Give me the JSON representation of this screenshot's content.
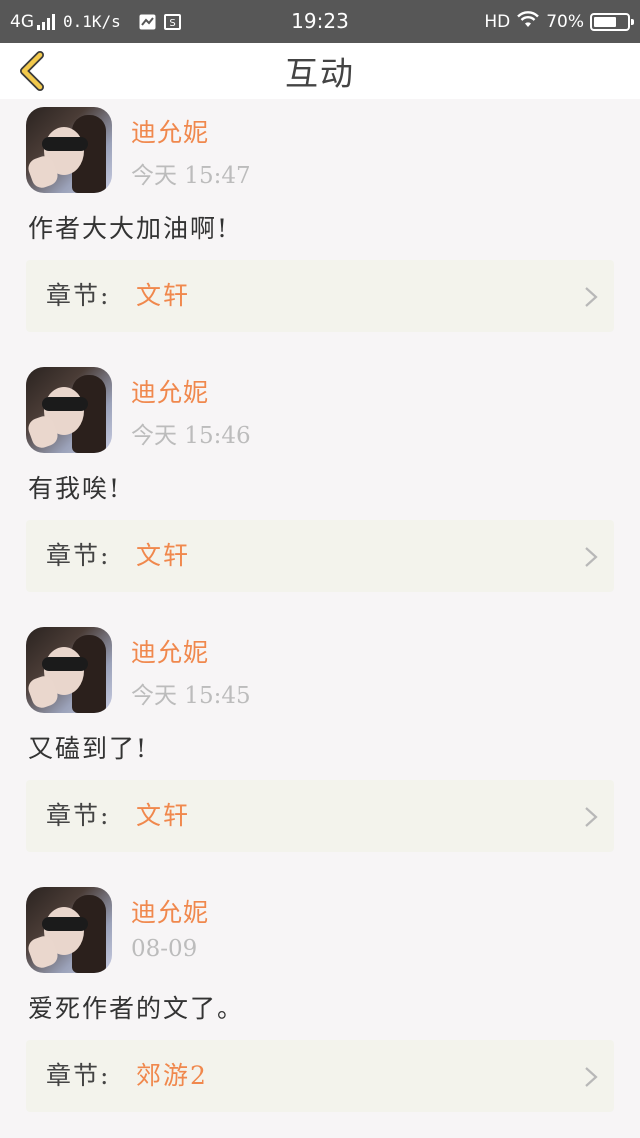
{
  "status_bar": {
    "network": "4G",
    "speed": "0.1K/s",
    "time": "19:23",
    "hd": "HD",
    "battery_percent": "70%",
    "battery_level": 0.7
  },
  "header": {
    "title": "互动"
  },
  "comments": [
    {
      "user": "迪允妮",
      "time": "今天 15:47",
      "text": "作者大大加油啊!",
      "chapter_prefix": "章节:",
      "chapter": "文轩"
    },
    {
      "user": "迪允妮",
      "time": "今天 15:46",
      "text": "有我唉!",
      "chapter_prefix": "章节:",
      "chapter": "文轩"
    },
    {
      "user": "迪允妮",
      "time": "今天 15:45",
      "text": "又磕到了!",
      "chapter_prefix": "章节:",
      "chapter": "文轩"
    },
    {
      "user": "迪允妮",
      "time": "08-09",
      "text": "爱死作者的文了。",
      "chapter_prefix": "章节:",
      "chapter": "郊游2"
    }
  ],
  "colors": {
    "accent": "#f0884d",
    "back_icon": "#f2c94c",
    "status_bar": "#575757",
    "chapter_bg": "#f3f3ec"
  }
}
